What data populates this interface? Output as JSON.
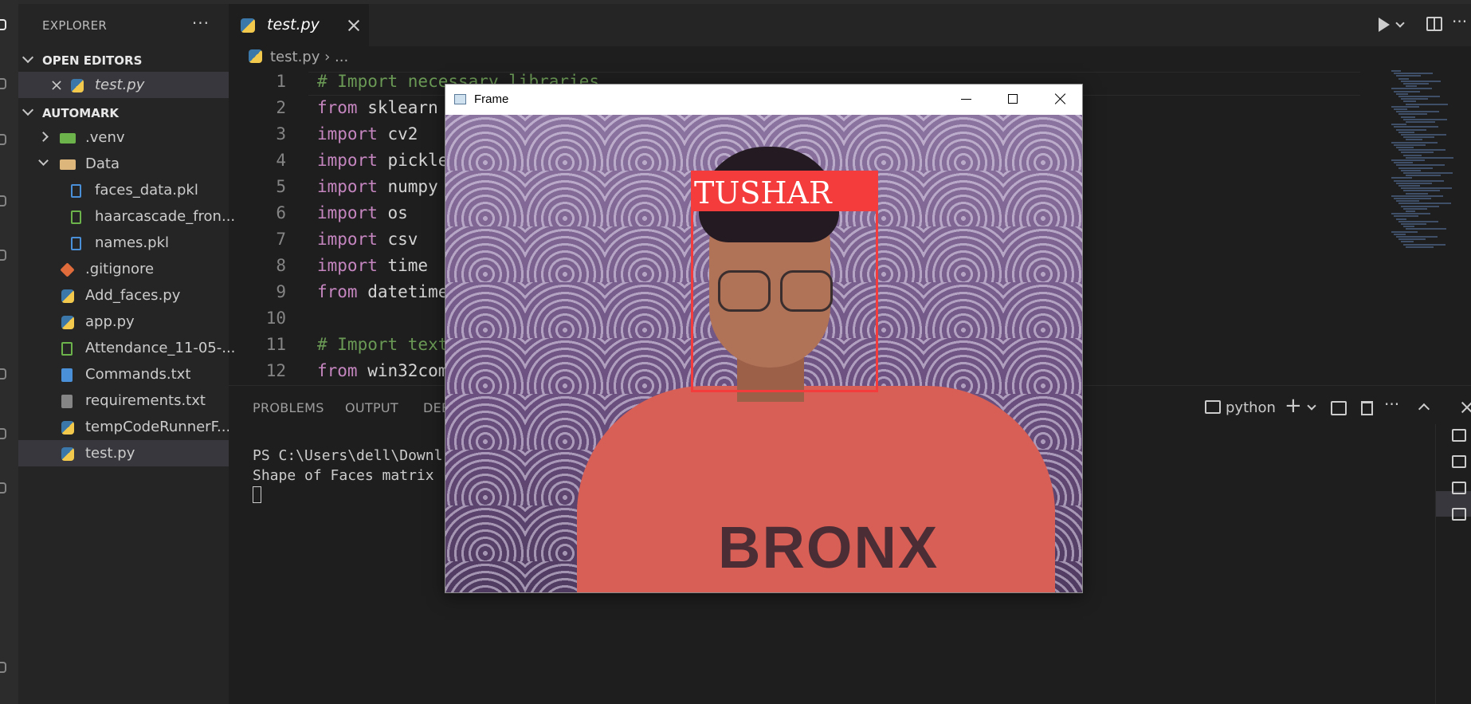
{
  "sidebar": {
    "header": "EXPLORER",
    "more": "···",
    "open_editors": "OPEN EDITORS",
    "open_files": [
      {
        "name": "test.py"
      }
    ],
    "workspace": "AUTOMARK",
    "tree": [
      {
        "name": ".venv",
        "type": "folder"
      },
      {
        "name": "Data",
        "type": "folder-open"
      },
      {
        "name": "faces_data.pkl",
        "type": "file"
      },
      {
        "name": "haarcascade_fron...",
        "type": "xml"
      },
      {
        "name": "names.pkl",
        "type": "file"
      },
      {
        "name": ".gitignore",
        "type": "git"
      },
      {
        "name": "Add_faces.py",
        "type": "python"
      },
      {
        "name": "app.py",
        "type": "python"
      },
      {
        "name": "Attendance_11-05-...",
        "type": "csv"
      },
      {
        "name": "Commands.txt",
        "type": "doc"
      },
      {
        "name": "requirements.txt",
        "type": "txt"
      },
      {
        "name": "tempCodeRunnerF...",
        "type": "python"
      },
      {
        "name": "test.py",
        "type": "python"
      }
    ]
  },
  "tabs": [
    {
      "label": "test.py",
      "active": true
    }
  ],
  "breadcrumb": {
    "file": "test.py",
    "rest": "..."
  },
  "editor": {
    "lines": [
      {
        "n": "1",
        "kw": "",
        "text": "# Import necessary libraries",
        "comment": true
      },
      {
        "n": "2",
        "kw": "from",
        "text": " sklearn"
      },
      {
        "n": "3",
        "kw": "import",
        "text": " cv2"
      },
      {
        "n": "4",
        "kw": "import",
        "text": " pickle"
      },
      {
        "n": "5",
        "kw": "import",
        "text": " numpy"
      },
      {
        "n": "6",
        "kw": "import",
        "text": " os"
      },
      {
        "n": "7",
        "kw": "import",
        "text": " csv"
      },
      {
        "n": "8",
        "kw": "import",
        "text": " time"
      },
      {
        "n": "9",
        "kw": "from",
        "text": " datetime"
      },
      {
        "n": "10",
        "kw": "",
        "text": ""
      },
      {
        "n": "11",
        "kw": "",
        "text": "# Import text",
        "comment": true
      },
      {
        "n": "12",
        "kw": "from",
        "text": " win32com"
      }
    ]
  },
  "panel": {
    "tabs": [
      "PROBLEMS",
      "OUTPUT",
      "DEBUG CONSOLE"
    ],
    "profile": "python",
    "terminal_lines": [
      "PS C:\\Users\\dell\\Downl",
      "Shape of Faces matrix"
    ]
  },
  "frame": {
    "title": "Frame",
    "detected_label": "TUSHAR",
    "shirt_text": "BRONX"
  },
  "colors": {
    "editor_bg": "#1e1e1e",
    "sidebar_bg": "#252526",
    "detection_box": "#f53c3c",
    "comment": "#6a9955",
    "keyword": "#c586c0"
  }
}
